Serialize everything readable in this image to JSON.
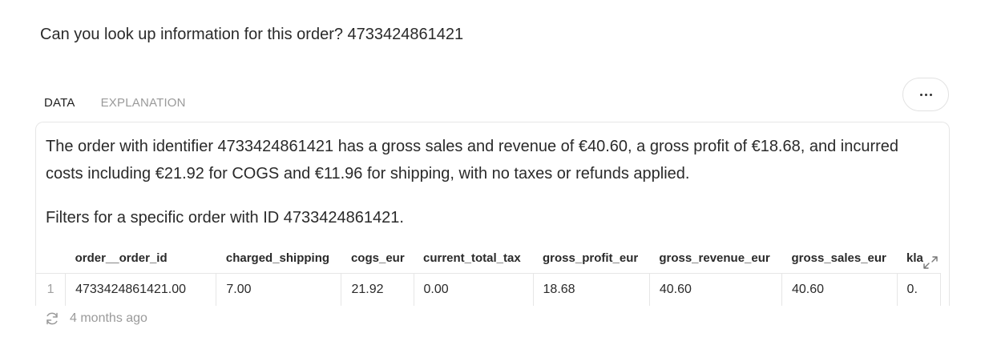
{
  "question": "Can you look up information for this order? 4733424861421",
  "tabs": [
    {
      "label": "DATA",
      "active": true
    },
    {
      "label": "EXPLANATION",
      "active": false
    }
  ],
  "more_icon": "ellipsis-icon",
  "summary": "The order with identifier 4733424861421 has a gross sales and revenue of €40.60, a gross profit of €18.68, and incurred costs including €21.92 for COGS and €11.96 for shipping, with no taxes or refunds applied.",
  "filter_text": "Filters for a specific order with ID 4733424861421.",
  "table": {
    "columns": [
      "",
      "order__order_id",
      "charged_shipping",
      "cogs_eur",
      "current_total_tax",
      "gross_profit_eur",
      "gross_revenue_eur",
      "gross_sales_eur",
      "kla"
    ],
    "rows": [
      [
        "1",
        "4733424861421.00",
        "7.00",
        "21.92",
        "0.00",
        "18.68",
        "40.60",
        "40.60",
        "0."
      ]
    ]
  },
  "expand_icon": "expand-icon",
  "footer": {
    "icon": "refresh-icon",
    "timestamp": "4 months ago"
  }
}
